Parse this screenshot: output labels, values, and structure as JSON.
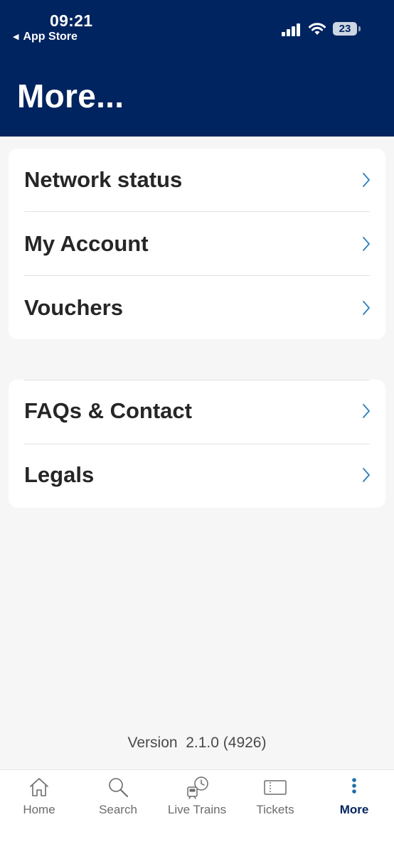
{
  "status_bar": {
    "time": "09:21",
    "back_app": "App Store",
    "battery": "23"
  },
  "header": {
    "title": "More..."
  },
  "menu_group_1": [
    {
      "label": "Network status"
    },
    {
      "label": "My Account"
    },
    {
      "label": "Vouchers"
    }
  ],
  "menu_group_2": [
    {
      "label": "FAQs & Contact"
    },
    {
      "label": "Legals"
    }
  ],
  "version": "Version  2.1.0 (4926)",
  "tabbar": {
    "items": [
      {
        "label": "Home",
        "icon": "home-icon"
      },
      {
        "label": "Search",
        "icon": "search-icon"
      },
      {
        "label": "Live Trains",
        "icon": "live-trains-icon"
      },
      {
        "label": "Tickets",
        "icon": "ticket-icon"
      },
      {
        "label": "More",
        "icon": "more-icon",
        "active": true
      }
    ]
  },
  "colors": {
    "header_bg": "#00245f",
    "page_bg": "#f6f6f6",
    "chevron": "#2a7fc0",
    "active_tab": "#00245f",
    "inactive_tab": "#6b6b6b"
  }
}
